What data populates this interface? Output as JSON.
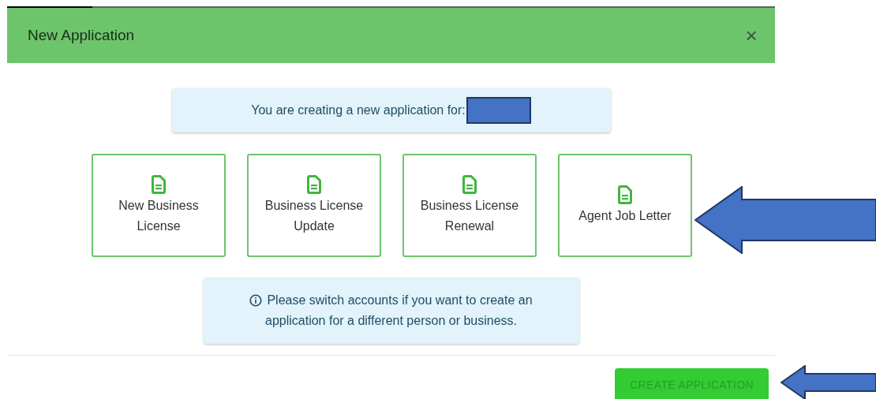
{
  "dialog": {
    "title": "New Application",
    "close_icon": "×"
  },
  "account_notice": {
    "text": "You are creating a new application for:"
  },
  "application_types": [
    {
      "label": "New Business License"
    },
    {
      "label": "Business License Update"
    },
    {
      "label": "Business License Renewal"
    },
    {
      "label": "Agent Job Letter"
    }
  ],
  "switch_notice": {
    "text": "Please switch accounts if you want to create an application for a different person or business."
  },
  "create_button": {
    "label": "CREATE APPLICATION",
    "disabled": true
  }
}
